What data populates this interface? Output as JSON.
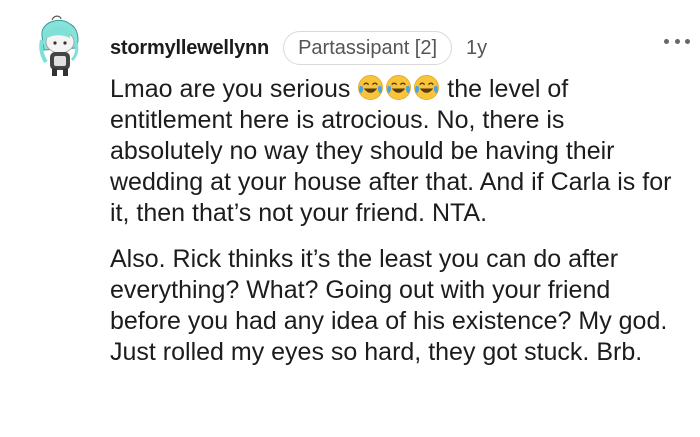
{
  "comment": {
    "username": "stormyllewellynn",
    "flair": "Partassipant [2]",
    "age": "1y",
    "paragraph1_before": "Lmao are you serious ",
    "paragraph1_emoji": "face-with-tears-of-joy x3",
    "paragraph1_after": " the level of entitlement here is atrocious. No, there is absolutely no way they should be having their wedding at your house after that. And if Carla is for it, then that’s not your friend. NTA.",
    "paragraph2": "Also. Rick thinks it’s the least you can do after everything? What? Going out with your friend before you had any idea of his existence? My god. Just rolled my eyes so hard, they got stuck. Brb."
  },
  "icons": {
    "avatar": "snoo-avatar-icon",
    "more": "more-options-icon",
    "emoji": "face-with-tears-of-joy-icon"
  },
  "colors": {
    "emoji_yellow": "#f9c33a",
    "emoji_tear": "#4aa3e0",
    "avatar_hair": "#7fe0d8",
    "text": "#1c1c1c",
    "muted": "#555555"
  }
}
